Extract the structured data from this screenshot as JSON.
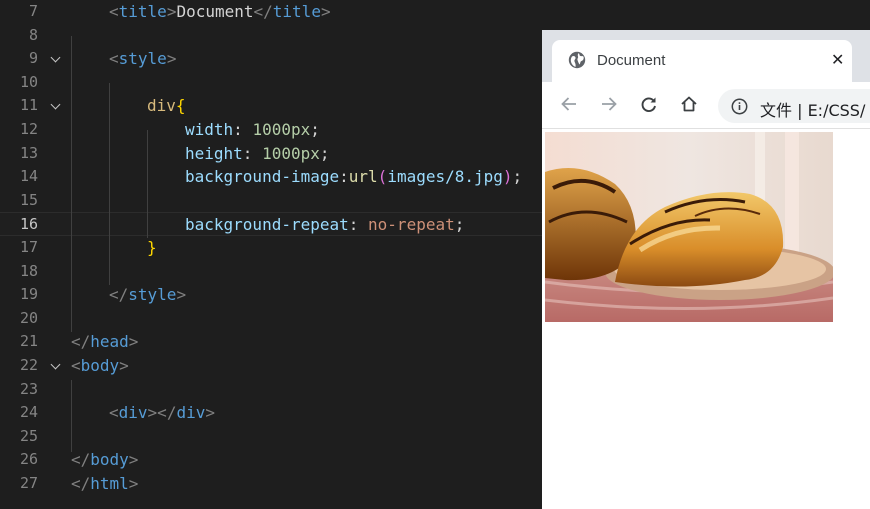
{
  "editor": {
    "lines": [
      {
        "num": "7",
        "tokens": [
          {
            "t": "<",
            "c": "punc"
          },
          {
            "t": "title",
            "c": "tag"
          },
          {
            "t": ">",
            "c": "punc"
          },
          {
            "t": "Document",
            "c": "text"
          },
          {
            "t": "</",
            "c": "punc"
          },
          {
            "t": "title",
            "c": "tag"
          },
          {
            "t": ">",
            "c": "punc"
          }
        ]
      },
      {
        "num": "8",
        "tokens": []
      },
      {
        "num": "9",
        "tokens": [
          {
            "t": "<",
            "c": "punc"
          },
          {
            "t": "style",
            "c": "tag"
          },
          {
            "t": ">",
            "c": "punc"
          }
        ]
      },
      {
        "num": "10",
        "tokens": []
      },
      {
        "num": "11",
        "tokens": [
          {
            "t": "div",
            "c": "sel"
          },
          {
            "t": "{",
            "c": "brace"
          }
        ]
      },
      {
        "num": "12",
        "tokens": [
          {
            "t": "width",
            "c": "prop"
          },
          {
            "t": ": ",
            "c": "text"
          },
          {
            "t": "1000px",
            "c": "num"
          },
          {
            "t": ";",
            "c": "text"
          }
        ]
      },
      {
        "num": "13",
        "tokens": [
          {
            "t": "height",
            "c": "prop"
          },
          {
            "t": ": ",
            "c": "text"
          },
          {
            "t": "1000px",
            "c": "num"
          },
          {
            "t": ";",
            "c": "text"
          }
        ]
      },
      {
        "num": "14",
        "tokens": [
          {
            "t": "background-image",
            "c": "prop"
          },
          {
            "t": ":",
            "c": "text"
          },
          {
            "t": "url",
            "c": "func"
          },
          {
            "t": "(",
            "c": "paren"
          },
          {
            "t": "images/8.jpg",
            "c": "prop"
          },
          {
            "t": ")",
            "c": "paren"
          },
          {
            "t": ";",
            "c": "text"
          }
        ]
      },
      {
        "num": "15",
        "tokens": []
      },
      {
        "num": "16",
        "tokens": [
          {
            "t": "background-repeat",
            "c": "prop"
          },
          {
            "t": ": ",
            "c": "text"
          },
          {
            "t": "no-repeat",
            "c": "str"
          },
          {
            "t": ";",
            "c": "text"
          }
        ]
      },
      {
        "num": "17",
        "tokens": [
          {
            "t": "}",
            "c": "brace"
          }
        ]
      },
      {
        "num": "18",
        "tokens": []
      },
      {
        "num": "19",
        "tokens": [
          {
            "t": "</",
            "c": "punc"
          },
          {
            "t": "style",
            "c": "tag"
          },
          {
            "t": ">",
            "c": "punc"
          }
        ]
      },
      {
        "num": "20",
        "tokens": []
      },
      {
        "num": "21",
        "tokens": [
          {
            "t": "</",
            "c": "punc"
          },
          {
            "t": "head",
            "c": "tag"
          },
          {
            "t": ">",
            "c": "punc"
          }
        ]
      },
      {
        "num": "22",
        "tokens": [
          {
            "t": "<",
            "c": "punc"
          },
          {
            "t": "body",
            "c": "tag"
          },
          {
            "t": ">",
            "c": "punc"
          }
        ]
      },
      {
        "num": "23",
        "tokens": []
      },
      {
        "num": "24",
        "tokens": [
          {
            "t": "<",
            "c": "punc"
          },
          {
            "t": "div",
            "c": "tag"
          },
          {
            "t": "></",
            "c": "punc"
          },
          {
            "t": "div",
            "c": "tag"
          },
          {
            "t": ">",
            "c": "punc"
          }
        ]
      },
      {
        "num": "25",
        "tokens": []
      },
      {
        "num": "26",
        "tokens": [
          {
            "t": "</",
            "c": "punc"
          },
          {
            "t": "body",
            "c": "tag"
          },
          {
            "t": ">",
            "c": "punc"
          }
        ]
      },
      {
        "num": "27",
        "tokens": [
          {
            "t": "</",
            "c": "punc"
          },
          {
            "t": "html",
            "c": "tag"
          },
          {
            "t": ">",
            "c": "punc"
          }
        ]
      }
    ],
    "active_line": "16",
    "folded_lines": [
      "9",
      "11",
      "22"
    ]
  },
  "browser": {
    "tab_title": "Document",
    "tab_close": "✕",
    "tab_icon": "globe-icon",
    "url": "文件 |  E:/CSS/",
    "omnibox_icon": "info-icon",
    "nav_icons": [
      "back-arrow-icon",
      "forward-arrow-icon",
      "reload-icon",
      "home-icon"
    ],
    "page_image": "croissant-photo"
  },
  "colors": {
    "editor_bg": "#1e1e1e",
    "line_number": "#858585",
    "tag": "#569cd6",
    "selector": "#d7ba7d",
    "property": "#9cdcfe",
    "number": "#b5cea8",
    "string": "#ce9178",
    "function": "#dcdcaa",
    "tabstrip_bg": "#dee1e6"
  }
}
